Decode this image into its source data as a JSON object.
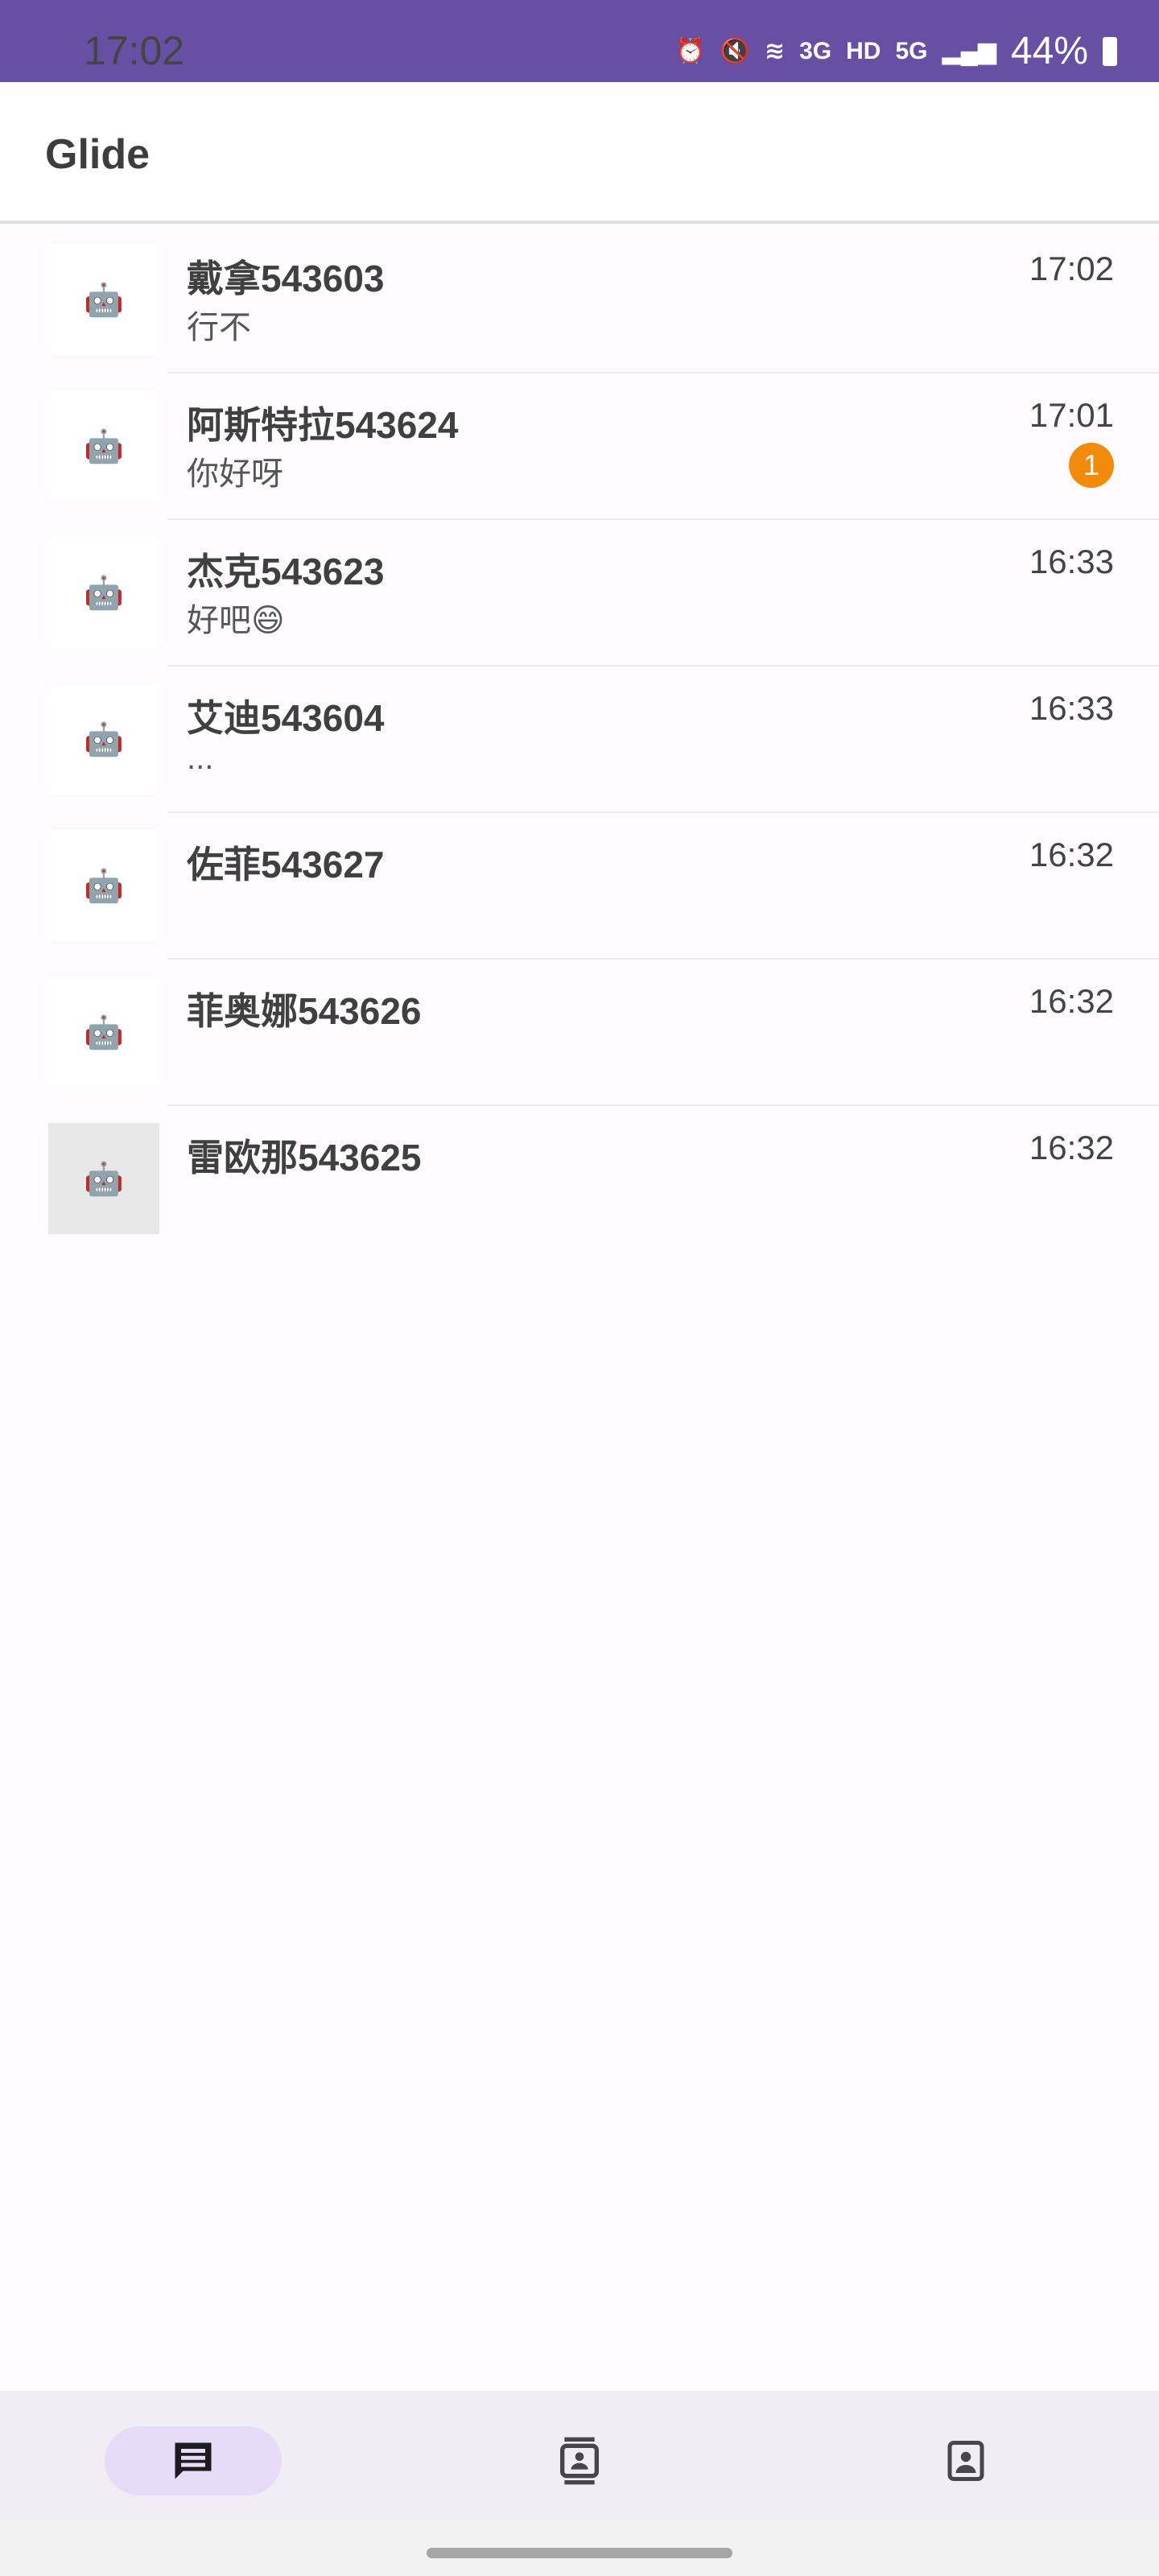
{
  "status_bar": {
    "time": "17:02",
    "battery": "44%",
    "network_labels": [
      "3G",
      "HD",
      "5G"
    ],
    "icons": [
      "alarm-icon",
      "mute-icon",
      "wifi-icon",
      "signal-icon",
      "battery-charging-icon"
    ]
  },
  "app_bar": {
    "title": "Glide"
  },
  "conversations": [
    {
      "name": "戴拿543603",
      "preview": "行不",
      "time": "17:02",
      "badge": null
    },
    {
      "name": "阿斯特拉543624",
      "preview": "你好呀",
      "time": "17:01",
      "badge": "1"
    },
    {
      "name": "杰克543623",
      "preview": "好吧😄",
      "time": "16:33",
      "badge": null
    },
    {
      "name": "艾迪543604",
      "preview": "...",
      "time": "16:33",
      "badge": null
    },
    {
      "name": "佐菲543627",
      "preview": "",
      "time": "16:32",
      "badge": null
    },
    {
      "name": "菲奥娜543626",
      "preview": "",
      "time": "16:32",
      "badge": null
    },
    {
      "name": "雷欧那543625",
      "preview": "",
      "time": "16:32",
      "badge": null
    }
  ],
  "bottom_nav": {
    "items": [
      {
        "icon": "chat-icon",
        "active": true
      },
      {
        "icon": "contacts-icon",
        "active": false
      },
      {
        "icon": "profile-icon",
        "active": false
      }
    ]
  },
  "colors": {
    "status_bar": "#6750a4",
    "badge": "#f28b0c",
    "nav_active": "#e6dcf7"
  }
}
